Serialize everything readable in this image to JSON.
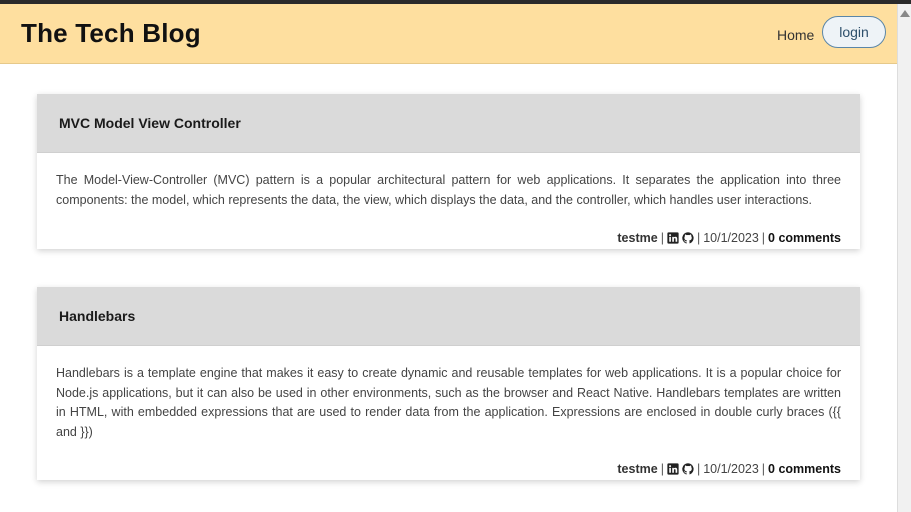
{
  "header": {
    "title": "The Tech Blog",
    "nav_home": "Home",
    "login_label": "login"
  },
  "posts": [
    {
      "title": "MVC Model View Controller",
      "body": "The Model-View-Controller (MVC) pattern is a popular architectural pattern for web applications. It separates the application into three components: the model, which represents the data, the view, which displays the data, and the controller, which handles user interactions.",
      "author": "testme",
      "date": "10/1/2023",
      "comments": "0 comments"
    },
    {
      "title": "Handlebars",
      "body": "Handlebars is a template engine that makes it easy to create dynamic and reusable templates for web applications. It is a popular choice for Node.js applications, but it can also be used in other environments, such as the browser and React Native. Handlebars templates are written in HTML, with embedded expressions that are used to render data from the application. Expressions are enclosed in double curly braces ({{ and }})",
      "author": "testme",
      "date": "10/1/2023",
      "comments": "0 comments"
    }
  ],
  "meta_separator": "|",
  "icons": {
    "linkedin": "linkedin-icon",
    "github": "github-icon"
  },
  "colors": {
    "header_bg": "#fedf9f",
    "post_header_bg": "#dadada",
    "login_border": "#5a86a8"
  }
}
